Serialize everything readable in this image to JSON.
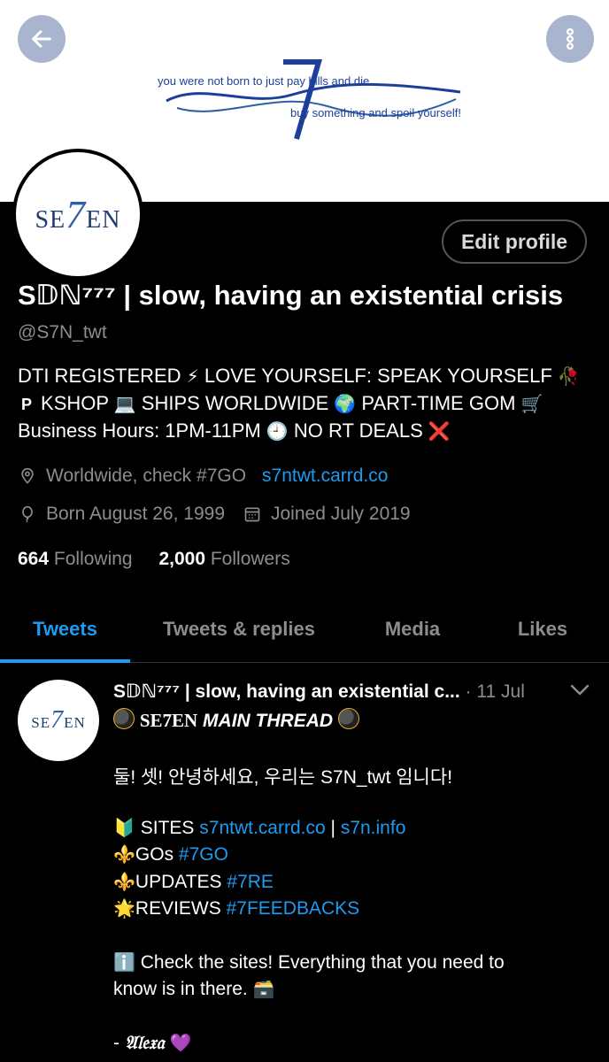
{
  "banner": {
    "line_top": "you were not born to just pay bills and die",
    "script_word": "se7en",
    "line_bottom": "buy something and spoil yourself!"
  },
  "avatar": {
    "logo_text_left": "SE",
    "logo_seven": "7",
    "logo_text_right": "EN"
  },
  "profile": {
    "edit_label": "Edit profile",
    "display_name": "S𝔻ℕ⁷⁷⁷ | slow, having an existential crisis",
    "handle": "@S7N_twt",
    "bio": {
      "line1_a": "DTI REGISTERED",
      "line1_emoji1": "⚡",
      "line1_b": "LOVE YOURSELF: SPEAK YOURSELF",
      "line1_emoji2": "🥀",
      "line2_badge": "P",
      "line2_a": "KSHOP",
      "line2_emoji1": "💻",
      "line2_b": "SHIPS WORLDWIDE",
      "line2_emoji2": "🌍",
      "line2_c": "PART-TIME GOM",
      "line2_emoji3": "🛒",
      "line3_a": "Business Hours: 1PM-11PM",
      "line3_emoji1": "🕘",
      "line3_b": "NO RT DEALS",
      "line3_emoji2": "❌"
    },
    "location": "Worldwide, check #7GO",
    "website": "s7ntwt.carrd.co",
    "birthday": "Born August 26, 1999",
    "joined": "Joined July 2019",
    "following_count": "664",
    "following_label": "Following",
    "followers_count": "2,000",
    "followers_label": "Followers"
  },
  "tabs": [
    "Tweets",
    "Tweets & replies",
    "Media",
    "Likes"
  ],
  "tweet": {
    "name": "S𝔻ℕ⁷⁷⁷ | slow, having an existential c...",
    "dot": "·",
    "time": "11 Jul",
    "title_a": "SE7EN",
    "title_b": "MAIN THREAD",
    "greeting": "둘! 셋! 안녕하세요, 우리는 S7N_twt 임니다!",
    "sites_emoji": "🔰",
    "sites_label": "SITES",
    "sites_link1": "s7ntwt.carrd.co",
    "sites_sep": "|",
    "sites_link2": "s7n.info",
    "gos_emoji": "⚜️",
    "gos_label": "GOs",
    "gos_tag": "#7GO",
    "updates_emoji": "⚜️",
    "updates_label": "UPDATES",
    "updates_tag": "#7RE",
    "reviews_emoji": "🌟",
    "reviews_label": "REVIEWS",
    "reviews_tag": "#7FEEDBACKS",
    "info_emoji": "ℹ️",
    "info_line1": "Check the sites! Everything that you need to",
    "info_line2": "know is in there.",
    "info_emoji2": "🗃️",
    "sign_dash": "-",
    "sign_name": "𝔄𝔩𝔢𝔵𝔞",
    "sign_emoji": "💜"
  },
  "colors": {
    "accent": "#1d9bf0",
    "muted": "#8d8d8d",
    "nav_button": "#a9b4cf"
  },
  "icons": [
    "back-arrow-icon",
    "more-vertical-icon",
    "location-icon",
    "balloon-icon",
    "calendar-icon",
    "chevron-down-icon"
  ]
}
